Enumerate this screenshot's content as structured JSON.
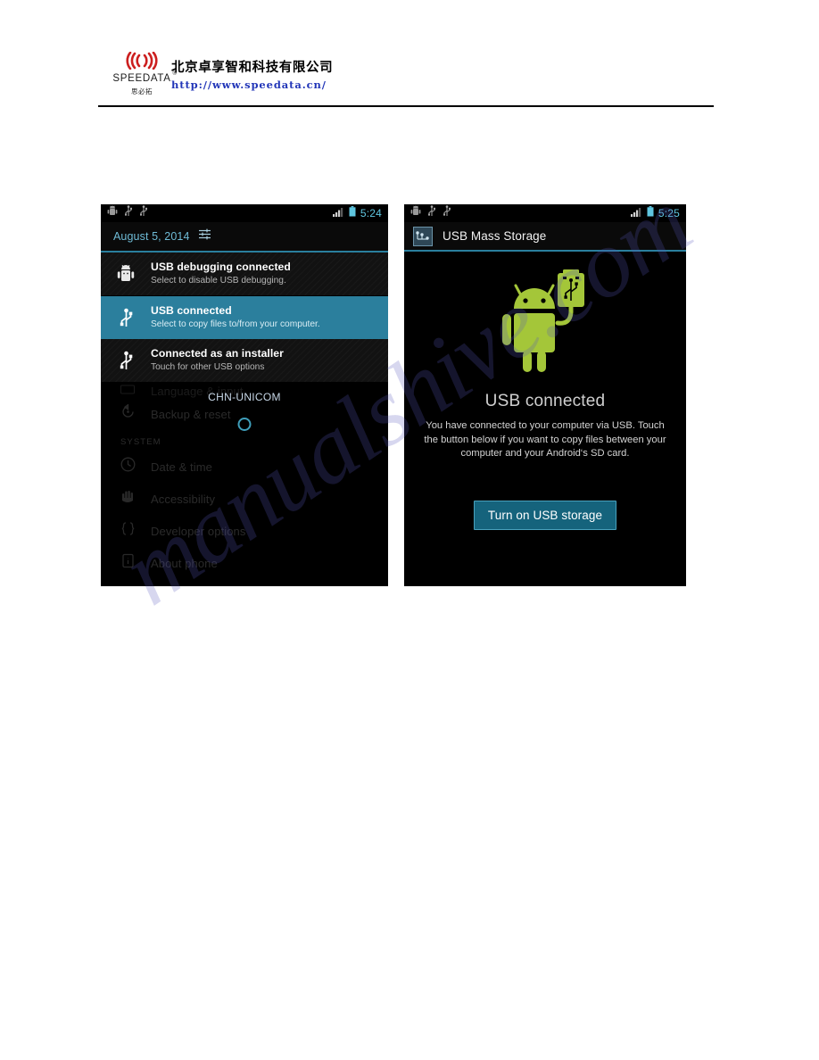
{
  "header": {
    "logo": {
      "wordmark": "SPEEDATA",
      "registered": "®",
      "chinese_sub": "思必拓",
      "icon": "signal-waves-icon",
      "color": "#cc1f1f"
    },
    "company_name_cn": "北京卓享智和科技有限公司",
    "company_url": "http://www.speedata.cn/",
    "url_color": "#2236b8"
  },
  "watermark": {
    "text": "manualshive.com"
  },
  "phone_left": {
    "status_bar": {
      "icons": [
        "android-debug-icon",
        "usb-icon",
        "usb-icon"
      ],
      "signal_icon": "signal-bars-icon",
      "battery_icon": "battery-icon",
      "time": "5:24",
      "accent_color": "#5fc6e0"
    },
    "shade": {
      "date": "August 5, 2014",
      "settings_icon": "quick-settings-icon"
    },
    "notifications": [
      {
        "icon": "android-debug-icon",
        "title": "USB debugging connected",
        "subtitle": "Select to disable USB debugging.",
        "highlighted": false
      },
      {
        "icon": "usb-icon",
        "title": "USB connected",
        "subtitle": "Select to copy files to/from your computer.",
        "highlighted": true
      },
      {
        "icon": "usb-icon",
        "title": "Connected as an installer",
        "subtitle": "Touch for other USB options",
        "highlighted": false
      }
    ],
    "background_settings": {
      "partial_row_label": "Language & input",
      "rows": [
        {
          "icon": "backup-icon",
          "label": "Backup & reset"
        }
      ],
      "section_label": "SYSTEM",
      "system_rows": [
        {
          "icon": "clock-icon",
          "label": "Date & time"
        },
        {
          "icon": "accessibility-hand-icon",
          "label": "Accessibility"
        },
        {
          "icon": "braces-icon",
          "label": "Developer options"
        },
        {
          "icon": "info-icon",
          "label": "About phone"
        }
      ]
    },
    "carrier": "CHN-UNICOM",
    "handle_icon": "shade-handle-circle"
  },
  "phone_right": {
    "status_bar": {
      "icons": [
        "android-debug-icon",
        "usb-icon",
        "usb-icon"
      ],
      "signal_icon": "signal-bars-icon",
      "battery_icon": "battery-icon",
      "time": "5:25",
      "accent_color": "#5fc6e0"
    },
    "action_bar": {
      "icon": "usb-mass-storage-icon",
      "title": "USB Mass Storage"
    },
    "illustration": {
      "icon": "android-robot-with-usb-icon",
      "robot_color": "#a4c639"
    },
    "heading": "USB connected",
    "description": "You have connected to your computer via USB. Touch the button below if you want to copy files between your computer and your Android‘s SD card.",
    "button_label": "Turn on USB storage",
    "button_color": "#15637c"
  }
}
